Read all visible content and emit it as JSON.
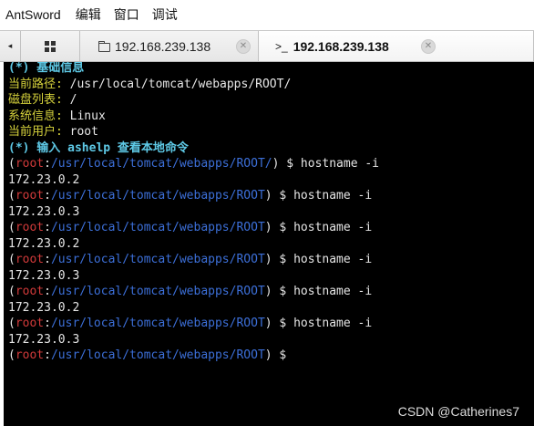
{
  "menu": {
    "app_name": "AntSword",
    "items": [
      "编辑",
      "窗口",
      "调试"
    ]
  },
  "tabs": {
    "arrow": "◂",
    "home_icon": "grid-icon",
    "tab1_label": "192.168.239.138",
    "tab2_label": "192.168.239.138",
    "tab2_prefix": ">_",
    "close": "✕"
  },
  "terminal": {
    "section_basic": "(*) 基础信息",
    "cwd_label": "当前路径:",
    "cwd_value": " /usr/local/tomcat/webapps/ROOT/",
    "disk_label": "磁盘列表:",
    "disk_value": " /",
    "sys_label": "系统信息:",
    "sys_value": " Linux",
    "user_label": "当前用户:",
    "user_value": " root",
    "help_line": "(*) 输入 ashelp 查看本地命令",
    "prompts": [
      {
        "user": "root",
        "path": "/usr/local/tomcat/webapps/ROOT/",
        "cmd": " $ hostname -i",
        "output": "172.23.0.2"
      },
      {
        "user": "root",
        "path": "/usr/local/tomcat/webapps/ROOT",
        "cmd": " $ hostname -i",
        "output": "172.23.0.3"
      },
      {
        "user": "root",
        "path": "/usr/local/tomcat/webapps/ROOT",
        "cmd": " $ hostname -i",
        "output": "172.23.0.2"
      },
      {
        "user": "root",
        "path": "/usr/local/tomcat/webapps/ROOT",
        "cmd": " $ hostname -i",
        "output": "172.23.0.3"
      },
      {
        "user": "root",
        "path": "/usr/local/tomcat/webapps/ROOT",
        "cmd": " $ hostname -i",
        "output": "172.23.0.2"
      },
      {
        "user": "root",
        "path": "/usr/local/tomcat/webapps/ROOT",
        "cmd": " $ hostname -i",
        "output": "172.23.0.3"
      },
      {
        "user": "root",
        "path": "/usr/local/tomcat/webapps/ROOT",
        "cmd": " $ ",
        "output": ""
      }
    ]
  },
  "watermark": "CSDN @Catherines7"
}
